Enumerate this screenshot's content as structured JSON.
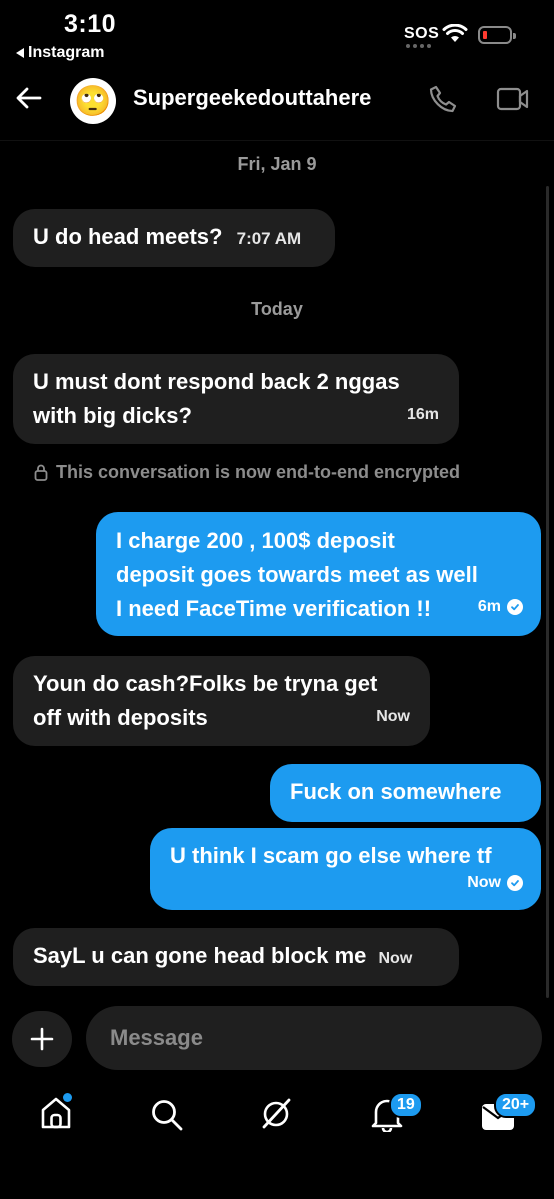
{
  "status_bar": {
    "time": "3:10",
    "back_app": "Instagram",
    "sos": "SOS"
  },
  "header": {
    "contact_name": "Supergeekedouttahere",
    "avatar_emoji": "🙄"
  },
  "dates": {
    "first": "Fri, Jan 9",
    "second": "Today"
  },
  "messages": [
    {
      "dir": "in",
      "lines": [
        "U do head meets?"
      ],
      "meta": "7:07 AM"
    },
    {
      "dir": "in",
      "lines": [
        "U must dont respond back 2 nggas",
        "with big dicks?"
      ],
      "meta": "16m"
    },
    {
      "dir": "out",
      "lines": [
        "I charge 200 , 100$ deposit",
        "deposit goes towards meet as well",
        "I need FaceTime verification !!"
      ],
      "meta": "6m",
      "seen": true
    },
    {
      "dir": "in",
      "lines": [
        "Youn do cash?Folks be tryna get",
        "off with deposits"
      ],
      "meta": "Now"
    },
    {
      "dir": "out",
      "lines": [
        "Fuck on somewhere"
      ]
    },
    {
      "dir": "out",
      "lines": [
        "U think I scam go else where tf"
      ],
      "meta": "Now",
      "seen": true
    },
    {
      "dir": "in",
      "lines": [
        "SayL u can gone head block me"
      ],
      "meta": "Now"
    }
  ],
  "encryption_notice": "This conversation is now end-to-end encrypted",
  "composer": {
    "placeholder": "Message"
  },
  "nav": {
    "notifications_badge": "19",
    "messages_badge": "20+"
  },
  "colors": {
    "accent": "#1d9bf0",
    "incoming_bubble": "#1f1f1f",
    "background": "#000000"
  }
}
